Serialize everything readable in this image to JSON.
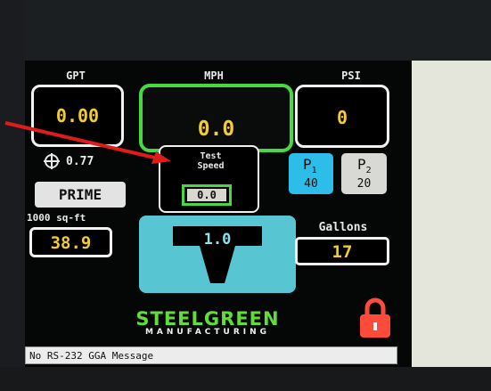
{
  "gpt": {
    "label": "GPT",
    "value": "0.00"
  },
  "mph": {
    "label": "MPH",
    "value": "0.0"
  },
  "psi": {
    "label": "PSI",
    "value": "0"
  },
  "gps_readout": {
    "icon": "crosshair-icon",
    "value": "0.77"
  },
  "prime_label": "PRIME",
  "test_speed": {
    "label_line1": "Test",
    "label_line2": "Speed",
    "value": "0.0"
  },
  "presets": [
    {
      "label": "P",
      "sub": "1",
      "value": "40",
      "selected": true
    },
    {
      "label": "P",
      "sub": "2",
      "value": "20",
      "selected": false
    }
  ],
  "area": {
    "label": "1000 sq-ft",
    "value": "38.9"
  },
  "gallons": {
    "label": "Gallons",
    "value": "17"
  },
  "nozzle_value": "1.0",
  "brand": {
    "line1": "STEELGREEN",
    "line2": "MANUFACTURING"
  },
  "lock_icon": "padlock-icon",
  "status_message": "No RS-232 GGA Message",
  "colors": {
    "accent_green": "#47d844",
    "cyan": "#57c6d2",
    "value_yellow": "#f2cc30",
    "lock_red": "#ff4b3a",
    "arrow_red": "#e01b1b"
  }
}
